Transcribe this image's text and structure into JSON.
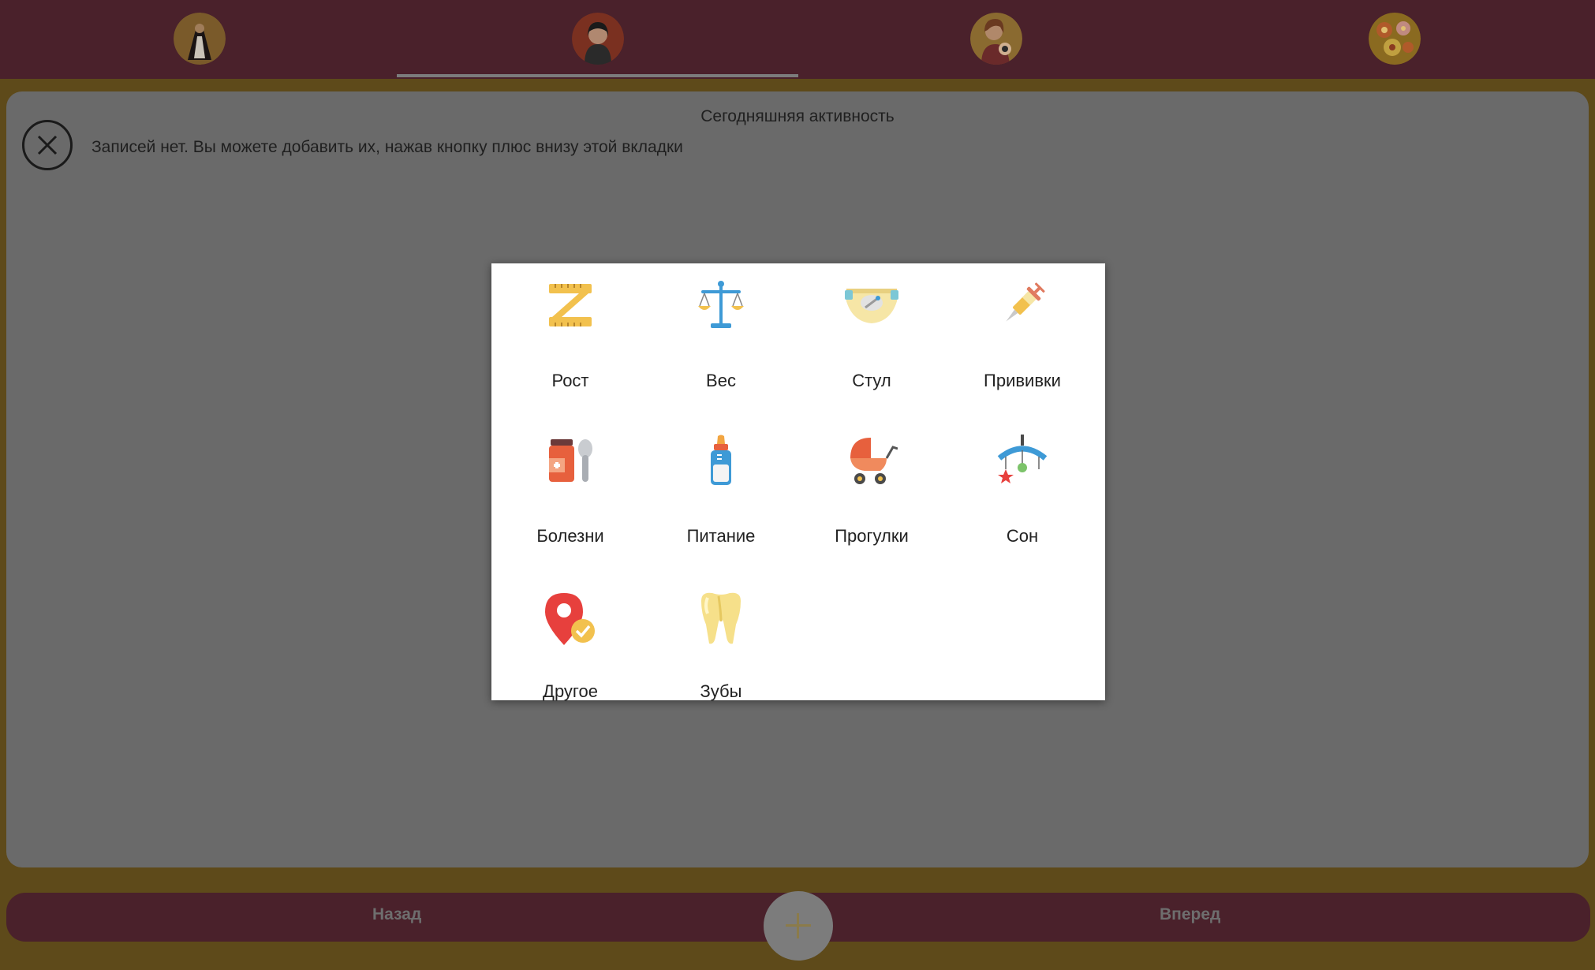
{
  "header": {
    "tabs": [
      {
        "name": "tab-mother",
        "icon": "woman-silhouette-avatar-icon"
      },
      {
        "name": "tab-profile",
        "icon": "woman-portrait-avatar-icon",
        "selected": true
      },
      {
        "name": "tab-mother-baby",
        "icon": "mother-with-baby-avatar-icon"
      },
      {
        "name": "tab-flowers",
        "icon": "flowers-avatar-icon"
      }
    ]
  },
  "main": {
    "title": "Сегодняшняя активность",
    "empty_message": "Записей нет. Вы можете добавить их, нажав кнопку плюс внизу этой вкладки"
  },
  "activity_menu": {
    "items": [
      {
        "label": "Рост",
        "icon": "ruler-icon"
      },
      {
        "label": "Вес",
        "icon": "scales-icon"
      },
      {
        "label": "Стул",
        "icon": "diaper-icon"
      },
      {
        "label": "Прививки",
        "icon": "syringe-icon"
      },
      {
        "label": "Болезни",
        "icon": "medicine-bottle-icon"
      },
      {
        "label": "Питание",
        "icon": "baby-bottle-icon"
      },
      {
        "label": "Прогулки",
        "icon": "stroller-icon"
      },
      {
        "label": "Сон",
        "icon": "crib-mobile-icon"
      },
      {
        "label": "Другое",
        "icon": "location-pin-check-icon"
      },
      {
        "label": "Зубы",
        "icon": "tooth-icon"
      }
    ]
  },
  "footer": {
    "back_label": "Назад",
    "forward_label": "Вперед",
    "add_icon": "plus-icon"
  },
  "colors": {
    "bar": "#4a212b",
    "backdrop": "#6a6a6a",
    "accent_gold": "#5e4a1a"
  }
}
